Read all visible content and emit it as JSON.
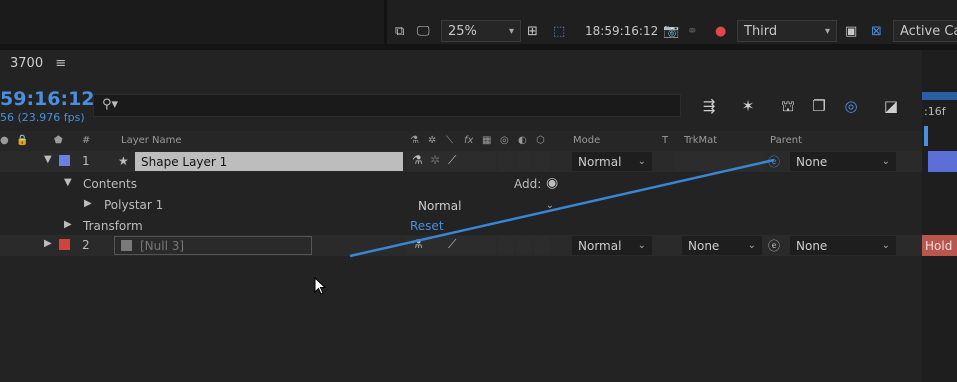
{
  "viewer": {
    "zoom": "25%",
    "timecode": "18:59:16:12",
    "view_mode": "Third",
    "camera": "Active Ca"
  },
  "timeline": {
    "comp_tab": "3700",
    "menu_glyph": "≡",
    "current_time": "59:16:12",
    "fps_text": "56 (23.976 fps)",
    "ruler_label": ":16f"
  },
  "columns": {
    "num": "#",
    "layer_name": "Layer Name",
    "switch_fx": "fx",
    "mode": "Mode",
    "t": "T",
    "trkmat": "TrkMat",
    "parent": "Parent"
  },
  "layers": [
    {
      "num": "1",
      "name": "Shape Layer 1",
      "mode": "Normal",
      "parent": "None",
      "label_color": "#6b7fe0"
    },
    {
      "num": "2",
      "name": "[Null 3]",
      "mode": "Normal",
      "trkmat": "None",
      "parent": "None",
      "label_color": "#d0453b",
      "right_label": "Hold"
    }
  ],
  "contents": {
    "label": "Contents",
    "add_label": "Add:",
    "polystar": "Polystar 1",
    "polystar_mode": "Normal",
    "transform": "Transform",
    "reset": "Reset"
  },
  "colors": {
    "accent": "#4a8fe0",
    "pick_line": "#3a86d6",
    "label_blue": "#6b7fe0",
    "label_red": "#d0453b"
  }
}
